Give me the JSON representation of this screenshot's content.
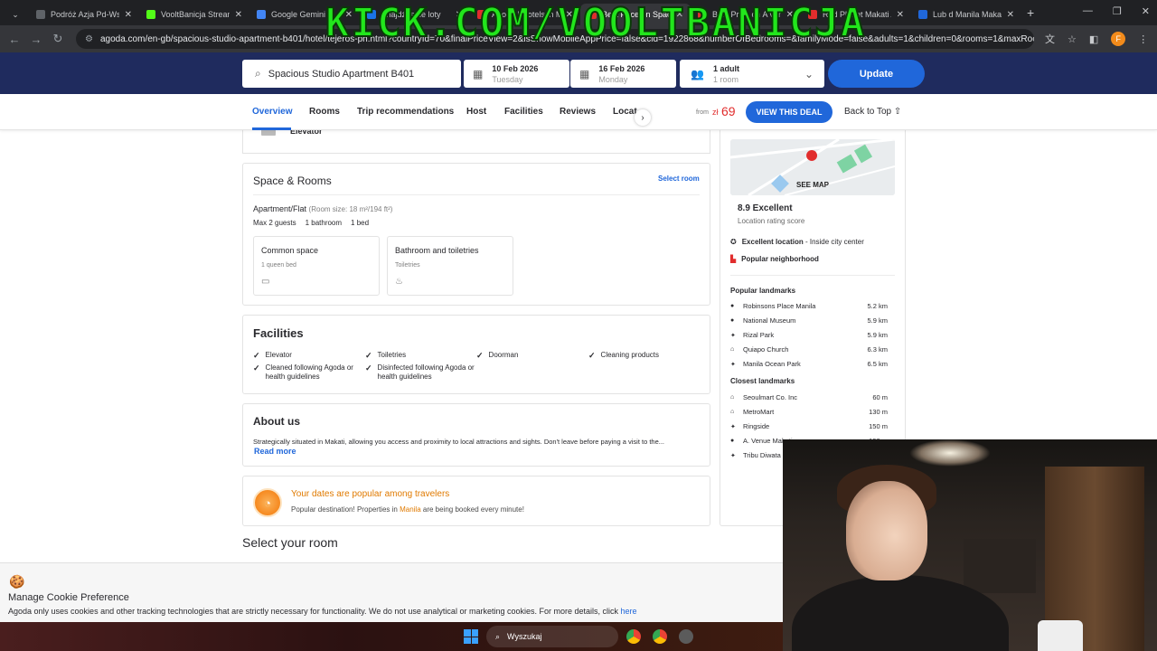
{
  "browser": {
    "tabs": [
      {
        "title": "Podróż Azja Pd-Wsch",
        "color": "#5f6368"
      },
      {
        "title": "VooltBanicja Stream",
        "color": "#53fc18"
      },
      {
        "title": "Google Gemini",
        "color": "#4285f4"
      },
      {
        "title": "Znajdź tanie loty",
        "color": "#1a73e8"
      },
      {
        "title": "Agoda | Hotels in M",
        "color": "#e12d2d"
      },
      {
        "title": "Best Price on Spacio",
        "color": "#e12d2d"
      },
      {
        "title": "Best Price on A ver",
        "color": "#e12d2d"
      },
      {
        "title": "Red Planet Makati Av",
        "color": "#e12d2d"
      },
      {
        "title": "Lub d Manila Makati",
        "color": "#2067da"
      }
    ],
    "url": "agoda.com/en-gb/spacious-studio-apartment-b401/hotel/tejeros-ph.html?countryId=70&finalPriceView=2&isShowMobileAppPrice=false&cid=1922868&numberOfBedrooms=&familyMode=false&adults=1&children=0&rooms=1&maxRooms=0&...",
    "profile_initial": "F"
  },
  "overlay": {
    "text": "KICK.COM/VOOLTBANICJA"
  },
  "search": {
    "property": "Spacious Studio Apartment B401",
    "checkin_date": "10 Feb 2026",
    "checkin_day": "Tuesday",
    "checkout_date": "16 Feb 2026",
    "checkout_day": "Monday",
    "guests": "1 adult",
    "rooms": "1 room",
    "update_label": "Update"
  },
  "nav": {
    "tabs": [
      "Overview",
      "Rooms",
      "Trip recommendations",
      "Host",
      "Facilities",
      "Reviews",
      "Locat"
    ],
    "from_label": "from",
    "currency": "zł",
    "price": "69",
    "deal_label": "VIEW THIS DEAL",
    "back_to_top": "Back to Top"
  },
  "amenity_top": {
    "label": "Elevator"
  },
  "space": {
    "title": "Space & Rooms",
    "select_room": "Select room",
    "apartment": "Apartment/Flat",
    "room_size": "(Room size: 18 m²/194 ft²)",
    "meta": [
      "Max 2 guests",
      "1 bathroom",
      "1 bed"
    ],
    "cards": [
      {
        "title": "Common space",
        "sub": "1 queen bed",
        "icon": "bed-icon"
      },
      {
        "title": "Bathroom and toiletries",
        "sub": "Toiletries",
        "icon": "toiletries-icon"
      }
    ]
  },
  "facilities": {
    "title": "Facilities",
    "items": [
      "Elevator",
      "Toiletries",
      "Doorman",
      "Cleaning products",
      "Cleaned following Agoda or health guidelines",
      "Disinfected following Agoda or health guidelines"
    ]
  },
  "about": {
    "title": "About us",
    "text": "Strategically situated in Makati, allowing you access and proximity to local attractions and sights. Don't leave before paying a visit to the...",
    "read_more": "Read more"
  },
  "popular": {
    "title": "Your dates are popular among travelers",
    "sub_before": "Popular destination! Properties in ",
    "city": "Manila",
    "sub_after": " are being booked every minute!"
  },
  "select_room_title": "Select your room",
  "location": {
    "see_map": "SEE MAP",
    "score": "8.9 Excellent",
    "score_sub": "Location rating score",
    "excellent_bold": "Excellent location",
    "excellent_rest": " - Inside city center",
    "neighborhood": "Popular neighborhood",
    "popular_head": "Popular landmarks",
    "popular": [
      {
        "name": "Robinsons Place Manila",
        "dist": "5.2 km"
      },
      {
        "name": "National Museum",
        "dist": "5.9 km"
      },
      {
        "name": "Rizal Park",
        "dist": "5.9 km"
      },
      {
        "name": "Quiapo Church",
        "dist": "6.3 km"
      },
      {
        "name": "Manila Ocean Park",
        "dist": "6.5 km"
      }
    ],
    "closest_head": "Closest landmarks",
    "closest": [
      {
        "name": "Seoulmart Co. Inc",
        "dist": "60 m"
      },
      {
        "name": "MetroMart",
        "dist": "130 m"
      },
      {
        "name": "Ringside",
        "dist": "150 m"
      },
      {
        "name": "A. Venue Makati",
        "dist": "190 m"
      },
      {
        "name": "Tribu Diwata",
        "dist": ""
      }
    ]
  },
  "cookie": {
    "title": "Manage Cookie Preference",
    "text": "Agoda only uses cookies and other tracking technologies that are strictly necessary for functionality. We do not use analytical or marketing cookies. For more details, click ",
    "link": "here"
  },
  "taskbar": {
    "search": "Wyszukaj"
  },
  "colors": {
    "agoda_blue": "#2067da",
    "header_navy": "#1f2b5e",
    "price_red": "#e12d2d",
    "kick_green": "#22e61c"
  }
}
